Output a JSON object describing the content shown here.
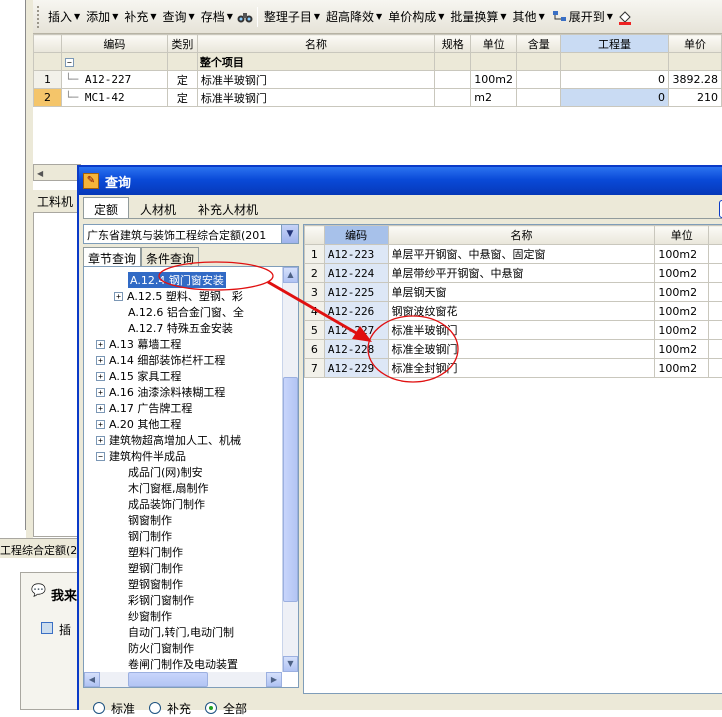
{
  "toolbar": {
    "items": [
      {
        "label": "插入",
        "icon": "insert-icon",
        "dropdown": true
      },
      {
        "label": "添加",
        "dropdown": true
      },
      {
        "label": "补充",
        "dropdown": true
      },
      {
        "label": "查询",
        "dropdown": true
      },
      {
        "label": "存档",
        "dropdown": true
      },
      {
        "label": "整理子目",
        "dropdown": true
      },
      {
        "label": "超高降效",
        "dropdown": true
      },
      {
        "label": "单价构成",
        "dropdown": true
      },
      {
        "label": "批量换算",
        "dropdown": true
      },
      {
        "label": "其他",
        "dropdown": true
      },
      {
        "label": "展开到",
        "dropdown": true
      }
    ]
  },
  "main_grid": {
    "columns": [
      "编码",
      "类别",
      "名称",
      "规格",
      "单位",
      "含量",
      "工程量",
      "单价"
    ],
    "group_row": {
      "name": "整个项目"
    },
    "rows": [
      {
        "num": "1",
        "code": "A12-227",
        "type": "定",
        "name": "标准半玻钢门",
        "spec": "",
        "unit": "100m2",
        "content": "",
        "qty": "0",
        "price": "3892.28"
      },
      {
        "num": "2",
        "code": "MC1-42",
        "type": "定",
        "name": "标准半玻钢门",
        "spec": "",
        "unit": "m2",
        "content": "",
        "qty": "0",
        "price": "210"
      }
    ]
  },
  "left_label": "工料机",
  "status_text": "工程综合定额(2",
  "bg_panel": {
    "title": "我来",
    "item": "插"
  },
  "dialog": {
    "title": "查询",
    "tabs": [
      "定额",
      "人材机",
      "补充人材机"
    ],
    "library": "广东省建筑与装饰工程综合定额(201",
    "subtabs": [
      "章节查询",
      "条件查询"
    ],
    "tree": [
      {
        "label": "A.12.4 钢门窗安装",
        "level": 3,
        "selected": true
      },
      {
        "label": "A.12.5 塑料、塑钢、彩",
        "level": 3,
        "expander": "+"
      },
      {
        "label": "A.12.6 铝合金门窗、全",
        "level": 3
      },
      {
        "label": "A.12.7 特殊五金安装",
        "level": 3
      },
      {
        "label": "A.13 幕墙工程",
        "level": 2,
        "expander": "+"
      },
      {
        "label": "A.14 细部装饰栏杆工程",
        "level": 2,
        "expander": "+"
      },
      {
        "label": "A.15 家具工程",
        "level": 2,
        "expander": "+"
      },
      {
        "label": "A.16 油漆涂料裱糊工程",
        "level": 2,
        "expander": "+"
      },
      {
        "label": "A.17 广告牌工程",
        "level": 2,
        "expander": "+"
      },
      {
        "label": "A.20 其他工程",
        "level": 2,
        "expander": "+"
      },
      {
        "label": "建筑物超高增加人工、机械",
        "level": 2,
        "expander": "+"
      },
      {
        "label": "建筑构件半成品",
        "level": 2,
        "expander": "-"
      },
      {
        "label": "成品门(网)制安",
        "level": 3
      },
      {
        "label": "木门窗框,扇制作",
        "level": 3
      },
      {
        "label": "成品装饰门制作",
        "level": 3
      },
      {
        "label": "钢窗制作",
        "level": 3
      },
      {
        "label": "钢门制作",
        "level": 3
      },
      {
        "label": "塑料门制作",
        "level": 3
      },
      {
        "label": "塑钢门制作",
        "level": 3
      },
      {
        "label": "塑钢窗制作",
        "level": 3
      },
      {
        "label": "彩钢门窗制作",
        "level": 3
      },
      {
        "label": "纱窗制作",
        "level": 3
      },
      {
        "label": "自动门,转门,电动门制",
        "level": 3
      },
      {
        "label": "防火门窗制作",
        "level": 3
      },
      {
        "label": "卷闸门制作及电动装置",
        "level": 3
      }
    ],
    "grid_columns": [
      "编码",
      "名称",
      "单位"
    ],
    "grid_rows": [
      {
        "num": "1",
        "code": "A12-223",
        "name": "单层平开钢窗、中悬窗、固定窗",
        "unit": "100m2"
      },
      {
        "num": "2",
        "code": "A12-224",
        "name": "单层带纱平开钢窗、中悬窗",
        "unit": "100m2"
      },
      {
        "num": "3",
        "code": "A12-225",
        "name": "单层钢天窗",
        "unit": "100m2"
      },
      {
        "num": "4",
        "code": "A12-226",
        "name": "钢窗波纹窗花",
        "unit": "100m2"
      },
      {
        "num": "5",
        "code": "A12-227",
        "name": "标准半玻钢门",
        "unit": "100m2"
      },
      {
        "num": "6",
        "code": "A12-228",
        "name": "标准全玻钢门",
        "unit": "100m2"
      },
      {
        "num": "7",
        "code": "A12-229",
        "name": "标准全封钢门",
        "unit": "100m2"
      }
    ],
    "radios": [
      {
        "label": "标准",
        "checked": false
      },
      {
        "label": "补充",
        "checked": false
      },
      {
        "label": "全部",
        "checked": true
      }
    ]
  },
  "annotation_color": "#e01010"
}
